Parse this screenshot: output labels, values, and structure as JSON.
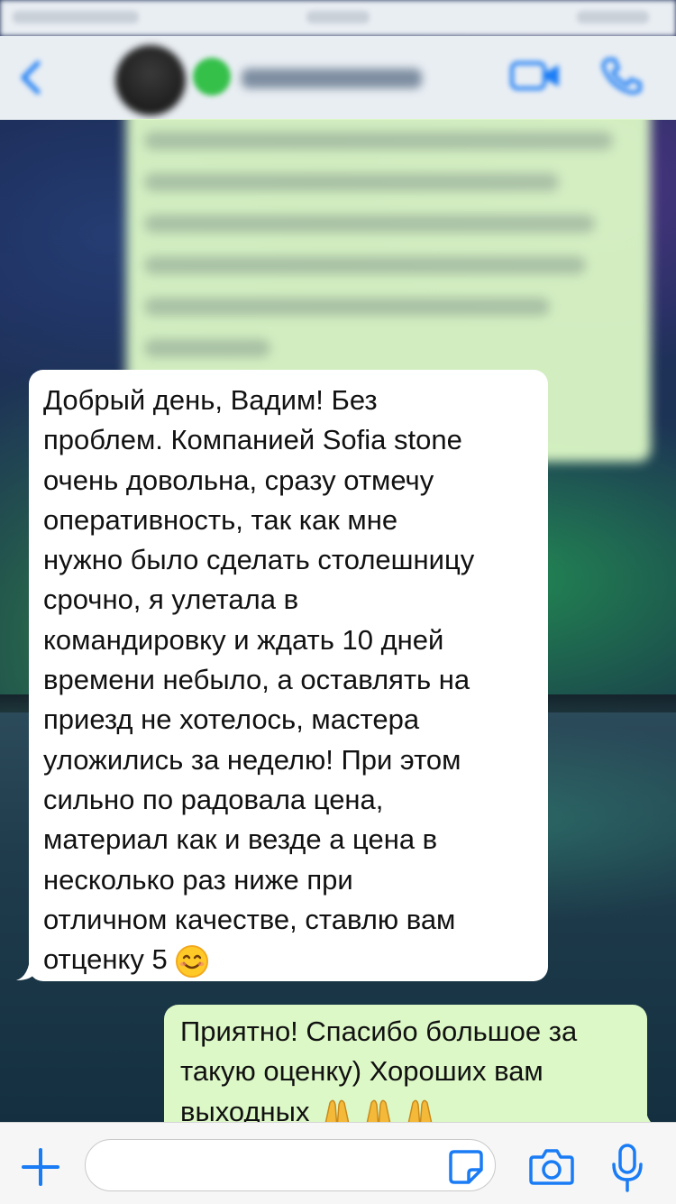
{
  "header": {
    "contact_name": "",
    "back_icon": "back-chevron-icon",
    "video_call_icon": "video-camera-icon",
    "voice_call_icon": "phone-icon"
  },
  "messages": [
    {
      "direction": "incoming",
      "text": "Добрый день, Вадим! Без\nпроблем. Компанией Sofia stone\nочень довольна, сразу отмечу\nоперативность, так как мне\nнужно было сделать столешницу\nсрочно, я улетала в\nкомандировку и ждать 10 дней\nвремени небыло, а оставлять на\nприезд не хотелось, мастера\nуложились за неделю! При этом\nсильно по радовала цена,\nматериал как и везде а цена в\nнесколько раз ниже при\nотличном качестве, ставлю вам\nотценку 5",
      "emoji": "smiling-face"
    },
    {
      "direction": "outgoing",
      "text": "Приятно! Спасибо большое за\nтакую оценку) Хороших вам\nвыходных",
      "emoji": "folded-hands-x3"
    }
  ],
  "input_bar": {
    "placeholder": "",
    "value": ""
  },
  "colors": {
    "outgoing_bubble": "#dcf8c6",
    "incoming_bubble": "#ffffff",
    "ios_blue": "#1a7cf5",
    "bar_background": "#f6f6f6"
  }
}
